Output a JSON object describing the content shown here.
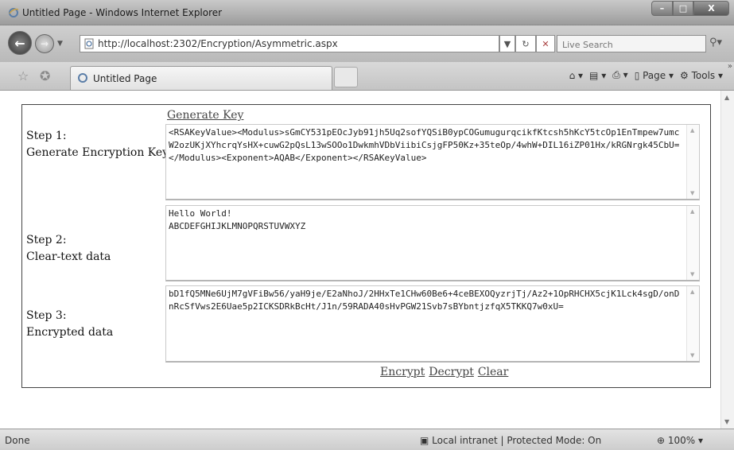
{
  "window": {
    "title": "Untitled Page - Windows Internet Explorer"
  },
  "address_bar": {
    "url": "http://localhost:2302/Encryption/Asymmetric.aspx"
  },
  "search": {
    "placeholder": "Live Search"
  },
  "tab": {
    "label": "Untitled Page"
  },
  "command_bar": {
    "page_label": "Page",
    "tools_label": "Tools"
  },
  "page": {
    "generate_key_label": "Generate Key",
    "steps": [
      {
        "line1": "Step 1:",
        "line2": "Generate Encryption Key",
        "value": "<RSAKeyValue><Modulus>sGmCY531pEOcJyb91jh5Uq2sofYQSiB0ypCOGumugurqcikfKtcsh5hKcY5tcOp1EnTmpew7umcW2ozUKjXYhcrqYsHX+cuwG2pQsL13wSOOo1DwkmhVDbViibiCsjgFP50Kz+35teOp/4whW+DIL16iZP01Hx/kRGNrgk45CbU=</Modulus><Exponent>AQAB</Exponent></RSAKeyValue>"
      },
      {
        "line1": "Step 2:",
        "line2": "Clear-text data",
        "value": "Hello World!\nABCDEFGHIJKLMNOPQRSTUVWXYZ"
      },
      {
        "line1": "Step 3:",
        "line2": "Encrypted data",
        "value": "bD1fQ5MNe6UjM7gVFiBw56/yaH9je/E2aNhoJ/2HHxTe1CHw60Be6+4ceBEXOQyzrjTj/Az2+1OpRHCHX5cjK1Lck4sgD/onDnRcSfVws2E6Uae5p2ICKSDRkBcHt/J1n/59RADA40sHvPGW21Svb7sBYbntjzfqX5TKKQ7w0xU="
      }
    ],
    "encrypt_label": "Encrypt",
    "decrypt_label": "Decrypt",
    "clear_label": "Clear"
  },
  "status": {
    "text": "Done",
    "zone": "Local intranet | Protected Mode: On",
    "zoom": "100%"
  }
}
